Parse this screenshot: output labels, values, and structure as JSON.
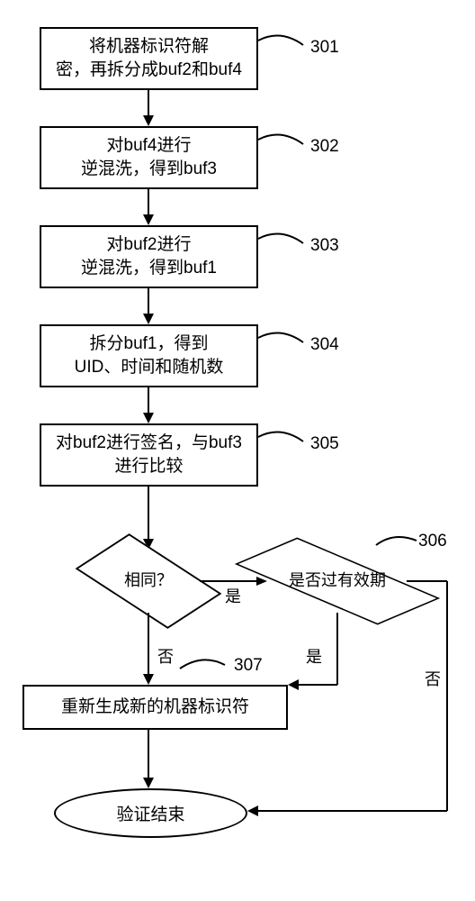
{
  "steps": {
    "s301": {
      "num": "301",
      "text1": "将机器标识符解",
      "text2": "密，再拆分成buf2和buf4"
    },
    "s302": {
      "num": "302",
      "text1": "对buf4进行",
      "text2": "逆混洗，得到buf3"
    },
    "s303": {
      "num": "303",
      "text1": "对buf2进行",
      "text2": "逆混洗，得到buf1"
    },
    "s304": {
      "num": "304",
      "text1": "拆分buf1，得到",
      "text2": "UID、时间和随机数"
    },
    "s305": {
      "num": "305",
      "text1": "对buf2进行签名，与buf3",
      "text2": "进行比较"
    },
    "s307": {
      "num": "307",
      "text": "重新生成新的机器标识符"
    }
  },
  "decisions": {
    "d_same": {
      "text": "相同？"
    },
    "d_expired": {
      "text1": "是否过有效期",
      "num": "306"
    }
  },
  "terminal": {
    "text": "验证结束"
  },
  "edges": {
    "yes_same": "是",
    "no_same": "否",
    "yes_exp": "是",
    "no_exp": "否"
  }
}
